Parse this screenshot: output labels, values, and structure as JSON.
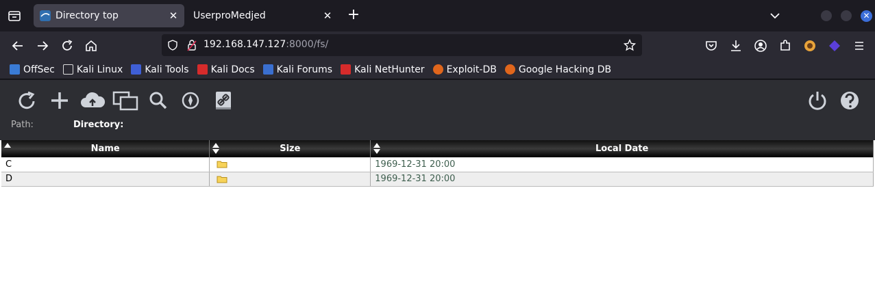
{
  "browser": {
    "tabs": [
      {
        "title": "Directory top",
        "active": true
      },
      {
        "title": "UserproMedjed",
        "active": false
      }
    ],
    "url": {
      "host": "192.168.147.127",
      "rest": ":8000/fs/"
    },
    "accent": "#3b6dd8"
  },
  "bookmarks": [
    {
      "label": "OffSec",
      "icon": "offsec-icon",
      "color": "#3a7bd5"
    },
    {
      "label": "Kali Linux",
      "icon": "kali-dragon-icon",
      "color": "#dddddd"
    },
    {
      "label": "Kali Tools",
      "icon": "kali-tools-icon",
      "color": "#3f5fd6"
    },
    {
      "label": "Kali Docs",
      "icon": "kali-docs-icon",
      "color": "#d62b2b"
    },
    {
      "label": "Kali Forums",
      "icon": "kali-forums-icon",
      "color": "#3a6fd0"
    },
    {
      "label": "Kali NetHunter",
      "icon": "nethunter-icon",
      "color": "#d62b2b"
    },
    {
      "label": "Exploit-DB",
      "icon": "exploit-db-icon",
      "color": "#e0661c"
    },
    {
      "label": "Google Hacking DB",
      "icon": "ghdb-icon",
      "color": "#e0661c"
    }
  ],
  "app": {
    "path_label": "Path:",
    "directory_label": "Directory:",
    "columns": [
      "Name",
      "Size",
      "Local Date"
    ],
    "rows": [
      {
        "name": "C",
        "date": "1969-12-31 20:00"
      },
      {
        "name": "D",
        "date": "1969-12-31 20:00"
      }
    ]
  }
}
